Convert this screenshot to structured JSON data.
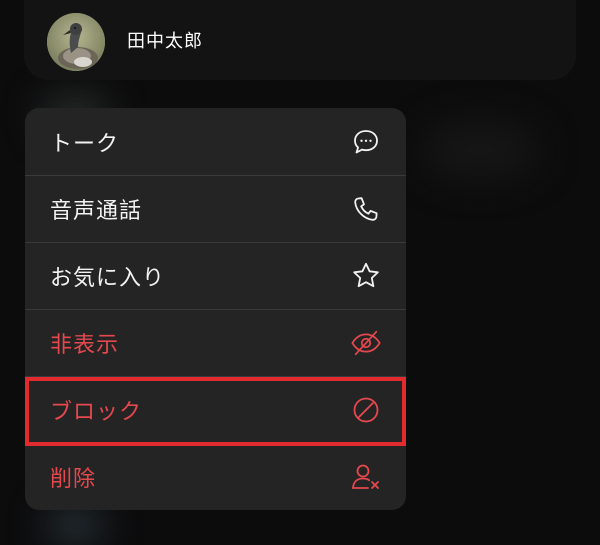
{
  "contact": {
    "name": "田中太郎",
    "avatar_icon": "duck-photo-avatar"
  },
  "menu": {
    "items": [
      {
        "label": "トーク",
        "icon": "chat-bubble-icon",
        "danger": false
      },
      {
        "label": "音声通話",
        "icon": "phone-icon",
        "danger": false
      },
      {
        "label": "お気に入り",
        "icon": "star-icon",
        "danger": false
      },
      {
        "label": "非表示",
        "icon": "eye-slash-icon",
        "danger": true
      },
      {
        "label": "ブロック",
        "icon": "block-icon",
        "danger": true
      },
      {
        "label": "削除",
        "icon": "remove-person-icon",
        "danger": true
      }
    ]
  },
  "highlight": {
    "target": "ブロック",
    "color": "#e22b2f"
  },
  "colors": {
    "background": "#0c0c0d",
    "menu_background": "#242425",
    "text": "#f2f2f2",
    "danger": "#e5484d"
  }
}
